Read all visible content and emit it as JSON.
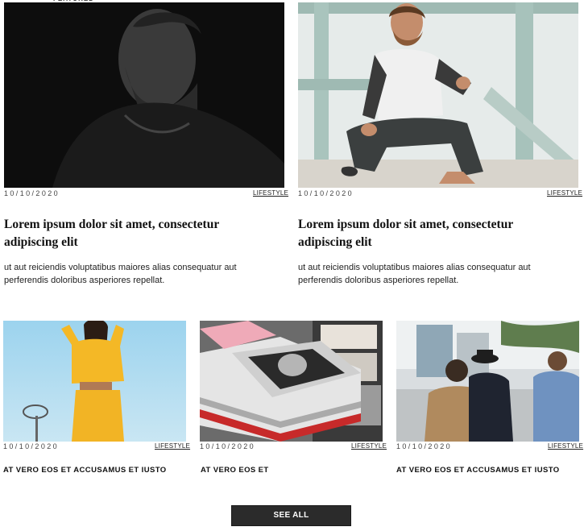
{
  "featured_cards": [
    {
      "date": "10/10/2020",
      "category": "LIFESTYLE",
      "title": "Lorem ipsum dolor sit amet, consectetur adipiscing elit",
      "excerpt": "ut aut reiciendis voluptatibus maiores alias consequatur aut perferendis doloribus asperiores repellat."
    },
    {
      "date": "10/10/2020",
      "category": "LIFESTYLE",
      "title": "Lorem ipsum dolor sit amet, consectetur adipiscing elit",
      "excerpt": "ut aut reiciendis voluptatibus maiores alias consequatur aut perferendis doloribus asperiores repellat."
    }
  ],
  "small_cards": [
    {
      "date": "10/10/2020",
      "category": "LIFESTYLE",
      "title": "AT VERO EOS ET ACCUSAMUS ET IUSTO"
    },
    {
      "date": "10/10/2020",
      "category": "LIFESTYLE",
      "title": "AT VERO EOS ET"
    },
    {
      "date": "10/10/2020",
      "category": "LIFESTYLE",
      "title": "AT VERO EOS ET ACCUSAMUS ET IUSTO"
    }
  ],
  "see_all_label": "SEE ALL",
  "colors": {
    "button_bg": "#2b2b2b",
    "text": "#111111"
  }
}
